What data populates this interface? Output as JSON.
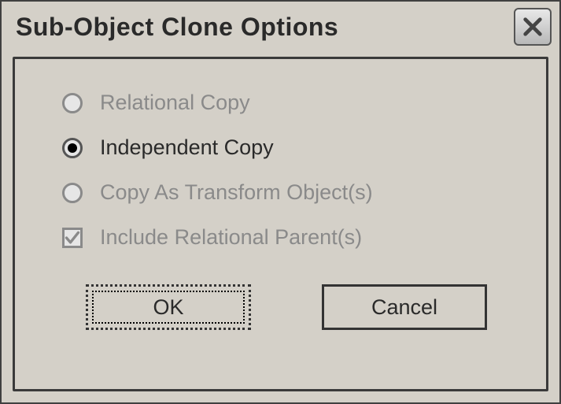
{
  "title": "Sub-Object Clone Options",
  "options": {
    "relational_copy": "Relational Copy",
    "independent_copy": "Independent Copy",
    "copy_as_transform": "Copy As Transform Object(s)",
    "include_parent": "Include Relational Parent(s)"
  },
  "buttons": {
    "ok": "OK",
    "cancel": "Cancel"
  }
}
